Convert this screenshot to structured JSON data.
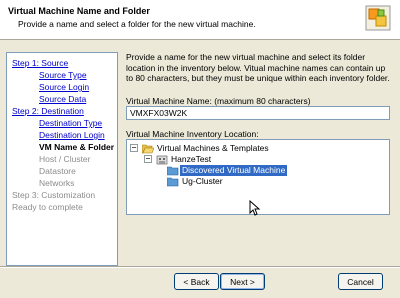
{
  "header": {
    "title": "Virtual Machine Name and Folder",
    "subtitle": "Provide a name and select a folder for the new virtual machine."
  },
  "steps": [
    {
      "label": "Step 1: Source",
      "state": "link"
    },
    {
      "label": "Source Type",
      "state": "link"
    },
    {
      "label": "Source Login",
      "state": "link"
    },
    {
      "label": "Source Data",
      "state": "link"
    },
    {
      "label": "Step 2: Destination",
      "state": "link"
    },
    {
      "label": "Destination Type",
      "state": "link"
    },
    {
      "label": "Destination Login",
      "state": "link"
    },
    {
      "label": "VM Name & Folder",
      "state": "current"
    },
    {
      "label": "Host / Cluster",
      "state": "disabled"
    },
    {
      "label": "Datastore",
      "state": "disabled"
    },
    {
      "label": "Networks",
      "state": "disabled"
    },
    {
      "label": "Step 3: Customization",
      "state": "disabled"
    },
    {
      "label": "Ready to complete",
      "state": "disabled"
    }
  ],
  "main": {
    "description": "Provide a name for the new virtual machine and select its folder location in the inventory below. Vitual machine names can contain up to 80 characters, but they must be unique within each inventory folder.",
    "name_label": "Virtual Machine Name:  (maximum 80 characters)",
    "name_value": "VMXFX03W2K",
    "location_label": "Virtual Machine Inventory Location:",
    "tree": {
      "root": "Virtual Machines & Templates",
      "datacenter": "HanzeTest",
      "folders": [
        "Discovered Virtual Machine",
        "Ug-Cluster"
      ],
      "selected": "Discovered Virtual Machine"
    }
  },
  "buttons": {
    "back": "< Back",
    "next": "Next >",
    "cancel": "Cancel"
  },
  "colors": {
    "link": "#0000cc",
    "selection": "#316ac5",
    "disabled": "#8c8c8c"
  }
}
